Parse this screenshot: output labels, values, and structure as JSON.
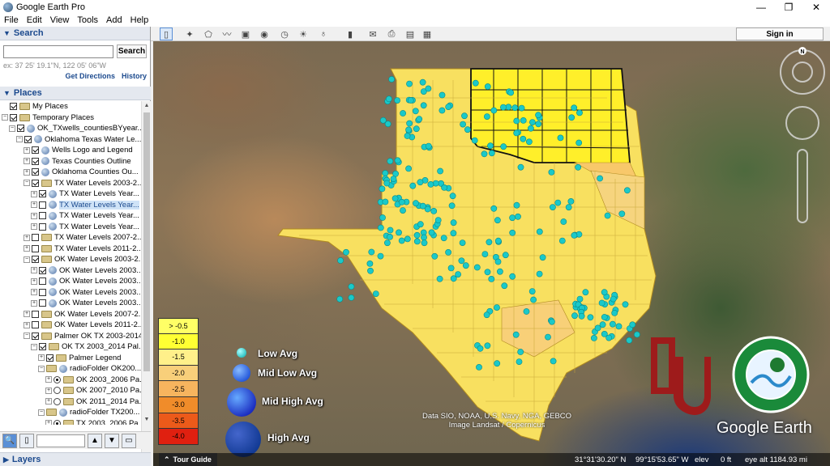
{
  "window": {
    "title": "Google Earth Pro",
    "minimize": "—",
    "restore": "❐",
    "close": "✕"
  },
  "menu": [
    "File",
    "Edit",
    "View",
    "Tools",
    "Add",
    "Help"
  ],
  "search": {
    "header": "Search",
    "input_value": "",
    "button": "Search",
    "hint": "ex: 37 25' 19.1\"N, 122 05' 06\"W",
    "get_directions": "Get Directions",
    "history": "History"
  },
  "places": {
    "header": "Places",
    "items": [
      {
        "indent": 0,
        "exp": "",
        "check": "on",
        "icon": "folder",
        "label": "My Places"
      },
      {
        "indent": 0,
        "exp": "−",
        "check": "on",
        "icon": "folder",
        "label": "Temporary Places"
      },
      {
        "indent": 1,
        "exp": "−",
        "check": "on",
        "icon": "kml",
        "label": "OK_TXwells_countiesBYyear..."
      },
      {
        "indent": 2,
        "exp": "−",
        "check": "on",
        "icon": "kml",
        "label": "Oklahoma Texas Water Le..."
      },
      {
        "indent": 3,
        "exp": "+",
        "check": "on",
        "icon": "kml",
        "label": "Wells Logo and Legend"
      },
      {
        "indent": 3,
        "exp": "+",
        "check": "on",
        "icon": "kml",
        "label": "Texas Counties Outline"
      },
      {
        "indent": 3,
        "exp": "+",
        "check": "on",
        "icon": "kml",
        "label": "Oklahoma Counties Ou..."
      },
      {
        "indent": 3,
        "exp": "−",
        "check": "on",
        "icon": "folder",
        "label": "TX Water Levels 2003-2..."
      },
      {
        "indent": 4,
        "exp": "+",
        "check": "on",
        "icon": "kml",
        "label": "TX Water Levels Year..."
      },
      {
        "indent": 4,
        "exp": "+",
        "check": "off",
        "icon": "kml",
        "label": "TX Water Levels Year...",
        "selected": true
      },
      {
        "indent": 4,
        "exp": "+",
        "check": "off",
        "icon": "kml",
        "label": "TX Water Levels Year..."
      },
      {
        "indent": 4,
        "exp": "+",
        "check": "off",
        "icon": "kml",
        "label": "TX Water Levels Year..."
      },
      {
        "indent": 3,
        "exp": "+",
        "check": "off",
        "icon": "folder",
        "label": "TX Water Levels 2007-2..."
      },
      {
        "indent": 3,
        "exp": "+",
        "check": "off",
        "icon": "folder",
        "label": "TX Water Levels 2011-2..."
      },
      {
        "indent": 3,
        "exp": "−",
        "check": "on",
        "icon": "folder",
        "label": "OK Water Levels 2003-2..."
      },
      {
        "indent": 4,
        "exp": "+",
        "check": "on",
        "icon": "kml",
        "label": "OK Water Levels 2003..."
      },
      {
        "indent": 4,
        "exp": "+",
        "check": "off",
        "icon": "kml",
        "label": "OK Water Levels 2003..."
      },
      {
        "indent": 4,
        "exp": "+",
        "check": "off",
        "icon": "kml",
        "label": "OK Water Levels 2003..."
      },
      {
        "indent": 4,
        "exp": "+",
        "check": "off",
        "icon": "kml",
        "label": "OK Water Levels 2003..."
      },
      {
        "indent": 3,
        "exp": "+",
        "check": "off",
        "icon": "folder",
        "label": "OK Water Levels 2007-2..."
      },
      {
        "indent": 3,
        "exp": "+",
        "check": "off",
        "icon": "folder",
        "label": "OK Water Levels 2011-2..."
      },
      {
        "indent": 3,
        "exp": "−",
        "check": "on",
        "icon": "folder",
        "label": "Palmer OK TX 2003-2014"
      },
      {
        "indent": 4,
        "exp": "−",
        "check": "on",
        "icon": "folder",
        "label": "OK TX 2003_2014 Pal..."
      },
      {
        "indent": 5,
        "exp": "+",
        "check": "on",
        "icon": "folder",
        "label": "Palmer Legend"
      },
      {
        "indent": 5,
        "exp": "−",
        "check": "radio",
        "icon": "kml",
        "label": "radioFolder OK200..."
      },
      {
        "indent": 6,
        "exp": "+",
        "check": "radio-on",
        "icon": "folder",
        "label": "OK 2003_2006 Pa..."
      },
      {
        "indent": 6,
        "exp": "+",
        "check": "radio-off",
        "icon": "folder",
        "label": "OK 2007_2010 Pa..."
      },
      {
        "indent": 6,
        "exp": "+",
        "check": "radio-off",
        "icon": "folder",
        "label": "OK 2011_2014 Pa..."
      },
      {
        "indent": 5,
        "exp": "−",
        "check": "radio",
        "icon": "kml",
        "label": "radioFolder TX200..."
      },
      {
        "indent": 6,
        "exp": "+",
        "check": "radio-on",
        "icon": "folder",
        "label": "TX 2003_2006 Pa..."
      }
    ]
  },
  "layers": {
    "header": "Layers"
  },
  "toolbar": {
    "signin": "Sign in"
  },
  "legend": {
    "scale": [
      {
        "label": "> -0.5",
        "color": "#ffff66"
      },
      {
        "label": "-1.0",
        "color": "#ffff33"
      },
      {
        "label": "-1.5",
        "color": "#fff08a"
      },
      {
        "label": "-2.0",
        "color": "#f8cf7a"
      },
      {
        "label": "-2.5",
        "color": "#f7b45e"
      },
      {
        "label": "-3.0",
        "color": "#f08c2a"
      },
      {
        "label": "-3.5",
        "color": "#ec5a1a"
      },
      {
        "label": "-4.0",
        "color": "#e02010"
      }
    ],
    "wells": [
      {
        "label": "Low Avg"
      },
      {
        "label": "Mid Low Avg"
      },
      {
        "label": "Mid High Avg"
      },
      {
        "label": "High Avg"
      }
    ]
  },
  "map": {
    "attribution_line1": "Data SIO, NOAA, U.S. Navy, NGA, GEBCO",
    "attribution_line2": "Image Landsat / Copernicus",
    "logo": "Google Earth",
    "compass": "N"
  },
  "status": {
    "tour_guide": "Tour Guide",
    "coords": "31°31'30.20\" N",
    "lon": "99°15'53.65\" W",
    "elev_label": "elev",
    "elev_value": "0 ft",
    "eye_alt": "eye alt 1184.93 mi"
  },
  "colors": {
    "accent": "#1c4a8e",
    "well": "#1ac9c9",
    "ou_red": "#9e1b1b"
  }
}
